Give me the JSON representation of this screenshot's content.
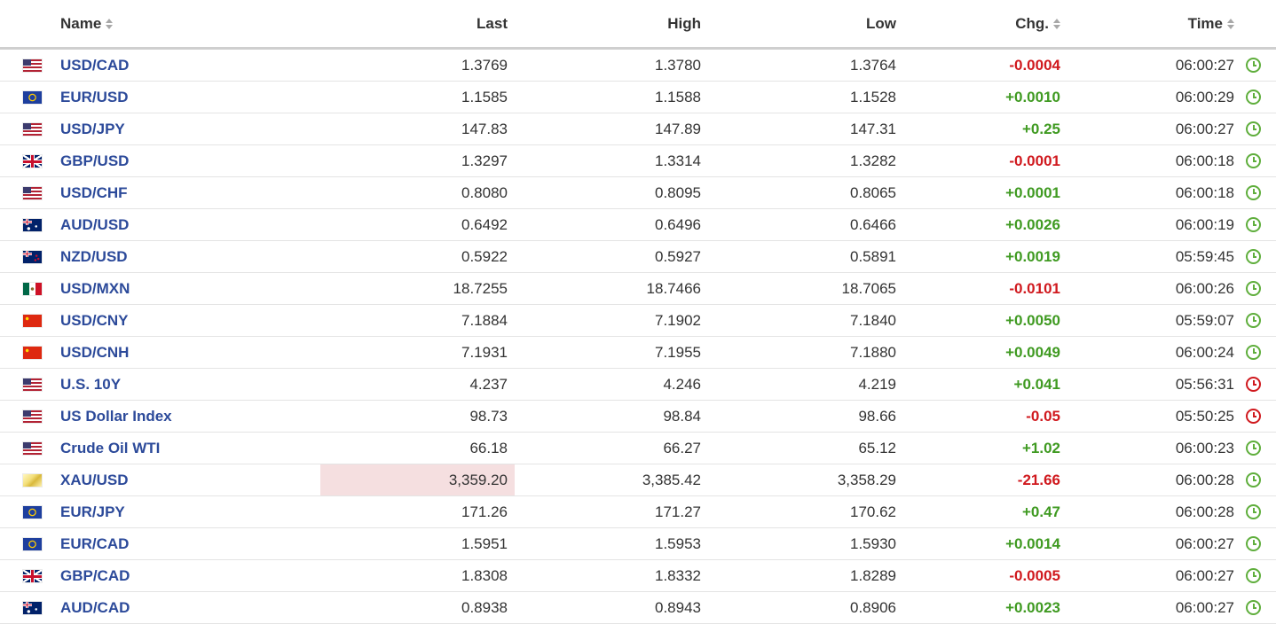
{
  "colors": {
    "name_link": "#2c4a9a",
    "positive": "#3f9a21",
    "negative": "#d0191e",
    "highlight_negative": "#f5dfe0",
    "clock_live": "#5fae3c",
    "clock_delayed": "#d0191e"
  },
  "header": {
    "name": "Name",
    "last": "Last",
    "high": "High",
    "low": "Low",
    "chg": "Chg.",
    "time": "Time"
  },
  "rows": [
    {
      "flag": "us-flag",
      "name": "USD/CAD",
      "last": "1.3769",
      "high": "1.3780",
      "low": "1.3764",
      "chg": "-0.0004",
      "time": "06:00:27",
      "clock": "clock-icon"
    },
    {
      "flag": "eu-flag",
      "name": "EUR/USD",
      "last": "1.1585",
      "high": "1.1588",
      "low": "1.1528",
      "chg": "+0.0010",
      "time": "06:00:29",
      "clock": "clock-icon"
    },
    {
      "flag": "us-flag",
      "name": "USD/JPY",
      "last": "147.83",
      "high": "147.89",
      "low": "147.31",
      "chg": "+0.25",
      "time": "06:00:27",
      "clock": "clock-icon"
    },
    {
      "flag": "gb-flag",
      "name": "GBP/USD",
      "last": "1.3297",
      "high": "1.3314",
      "low": "1.3282",
      "chg": "-0.0001",
      "time": "06:00:18",
      "clock": "clock-icon"
    },
    {
      "flag": "us-flag",
      "name": "USD/CHF",
      "last": "0.8080",
      "high": "0.8095",
      "low": "0.8065",
      "chg": "+0.0001",
      "time": "06:00:18",
      "clock": "clock-icon"
    },
    {
      "flag": "au-flag",
      "name": "AUD/USD",
      "last": "0.6492",
      "high": "0.6496",
      "low": "0.6466",
      "chg": "+0.0026",
      "time": "06:00:19",
      "clock": "clock-icon"
    },
    {
      "flag": "nz-flag",
      "name": "NZD/USD",
      "last": "0.5922",
      "high": "0.5927",
      "low": "0.5891",
      "chg": "+0.0019",
      "time": "05:59:45",
      "clock": "clock-icon"
    },
    {
      "flag": "mx-flag",
      "name": "USD/MXN",
      "last": "18.7255",
      "high": "18.7466",
      "low": "18.7065",
      "chg": "-0.0101",
      "time": "06:00:26",
      "clock": "clock-icon"
    },
    {
      "flag": "cn-flag",
      "name": "USD/CNY",
      "last": "7.1884",
      "high": "7.1902",
      "low": "7.1840",
      "chg": "+0.0050",
      "time": "05:59:07",
      "clock": "clock-icon"
    },
    {
      "flag": "cn-flag",
      "name": "USD/CNH",
      "last": "7.1931",
      "high": "7.1955",
      "low": "7.1880",
      "chg": "+0.0049",
      "time": "06:00:24",
      "clock": "clock-icon"
    },
    {
      "flag": "us-flag",
      "name": "U.S. 10Y",
      "last": "4.237",
      "high": "4.246",
      "low": "4.219",
      "chg": "+0.041",
      "time": "05:56:31",
      "clock": "delayed-clock-icon"
    },
    {
      "flag": "us-flag",
      "name": "US Dollar Index",
      "last": "98.73",
      "high": "98.84",
      "low": "98.66",
      "chg": "-0.05",
      "time": "05:50:25",
      "clock": "delayed-clock-icon"
    },
    {
      "flag": "us-flag",
      "name": "Crude Oil WTI",
      "last": "66.18",
      "high": "66.27",
      "low": "65.12",
      "chg": "+1.02",
      "time": "06:00:23",
      "clock": "clock-icon"
    },
    {
      "flag": "gold-icon",
      "name": "XAU/USD",
      "last": "3,359.20",
      "high": "3,385.42",
      "low": "3,358.29",
      "chg": "-21.66",
      "time": "06:00:28",
      "clock": "clock-icon",
      "last_highlight": "negative"
    },
    {
      "flag": "eu-flag",
      "name": "EUR/JPY",
      "last": "171.26",
      "high": "171.27",
      "low": "170.62",
      "chg": "+0.47",
      "time": "06:00:28",
      "clock": "clock-icon"
    },
    {
      "flag": "eu-flag",
      "name": "EUR/CAD",
      "last": "1.5951",
      "high": "1.5953",
      "low": "1.5930",
      "chg": "+0.0014",
      "time": "06:00:27",
      "clock": "clock-icon"
    },
    {
      "flag": "gb-flag",
      "name": "GBP/CAD",
      "last": "1.8308",
      "high": "1.8332",
      "low": "1.8289",
      "chg": "-0.0005",
      "time": "06:00:27",
      "clock": "clock-icon"
    },
    {
      "flag": "au-flag",
      "name": "AUD/CAD",
      "last": "0.8938",
      "high": "0.8943",
      "low": "0.8906",
      "chg": "+0.0023",
      "time": "06:00:27",
      "clock": "clock-icon"
    }
  ]
}
